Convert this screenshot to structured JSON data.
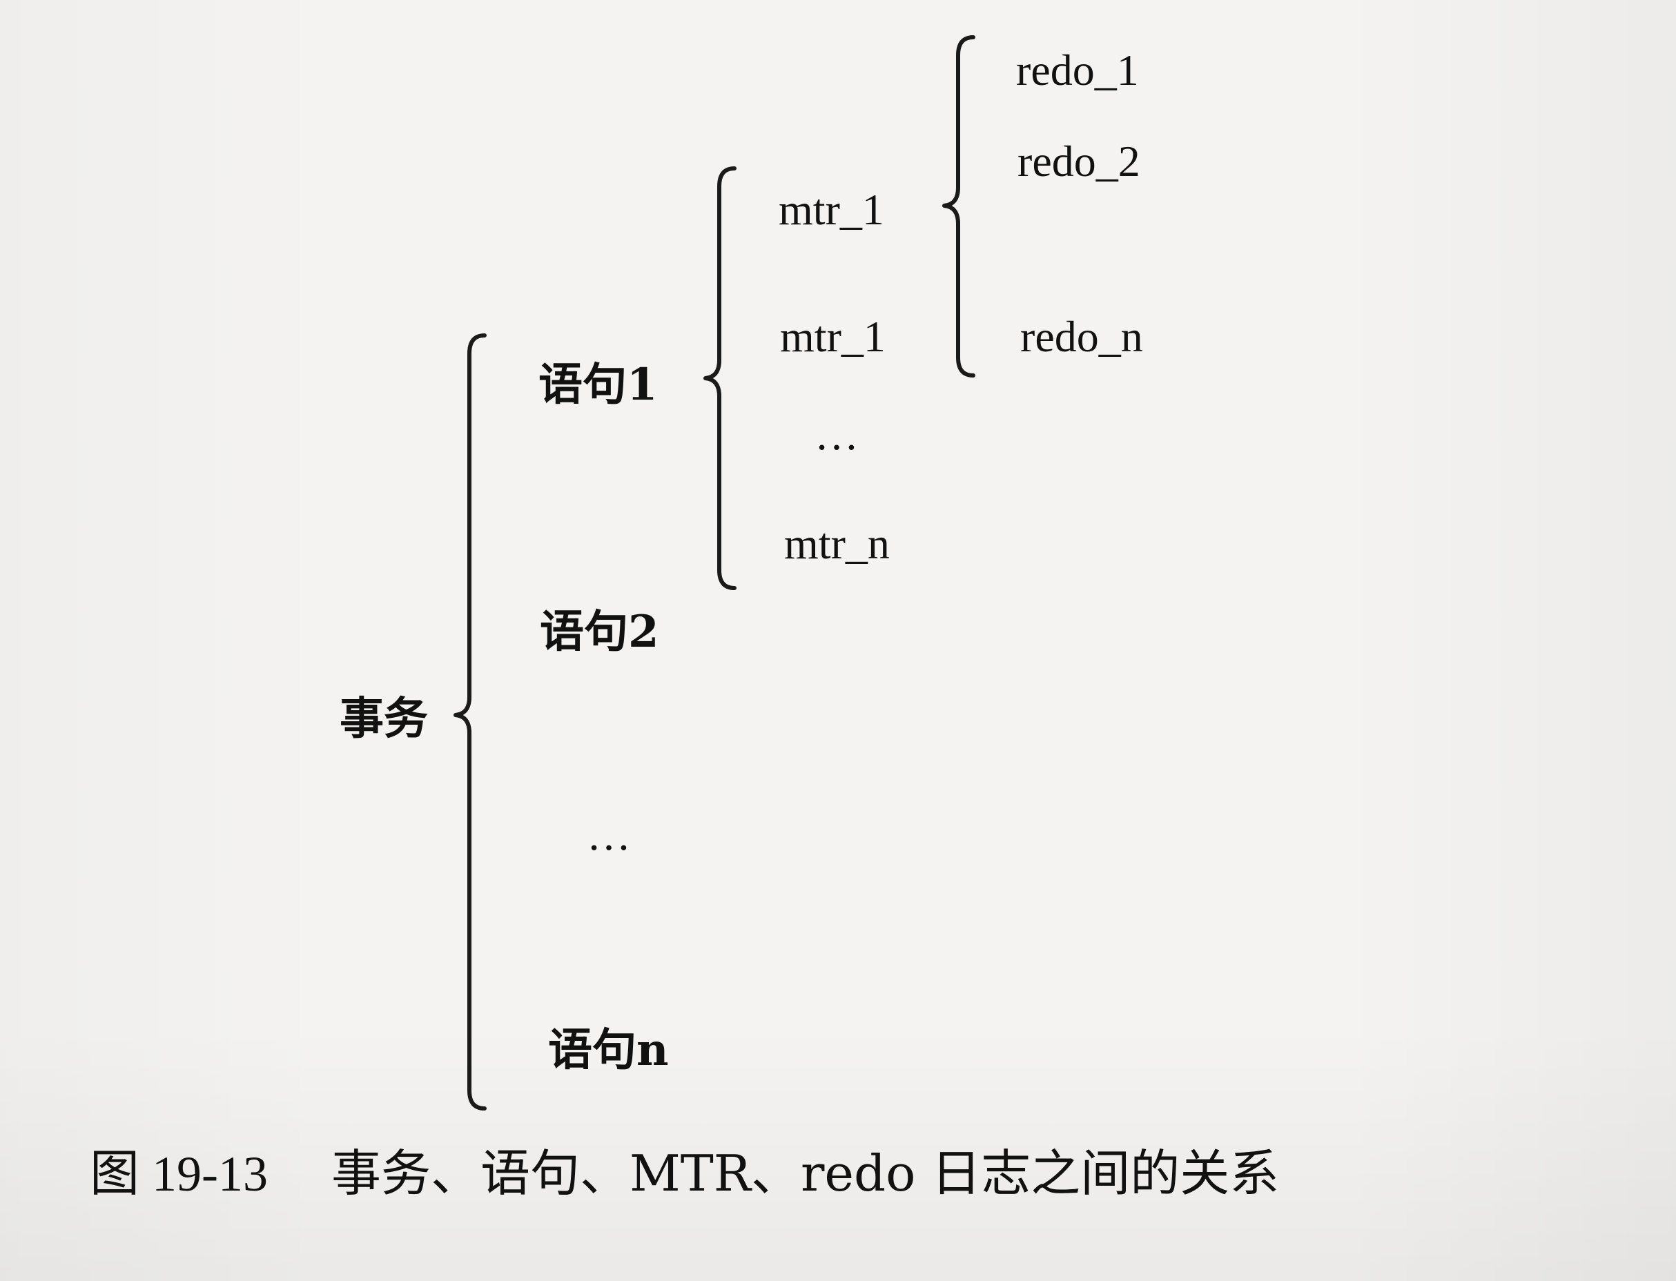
{
  "diagram": {
    "root": "事务",
    "statements": [
      "语句1",
      "语句2",
      "…",
      "语句n"
    ],
    "mtrs": [
      "mtr_1",
      "mtr_1",
      "…",
      "mtr_n"
    ],
    "redos": [
      "redo_1",
      "redo_2",
      "redo_n"
    ]
  },
  "caption": {
    "figure_label": "图",
    "figure_number": "19-13",
    "text": "事务、语句、MTR、redo 日志之间的关系"
  }
}
